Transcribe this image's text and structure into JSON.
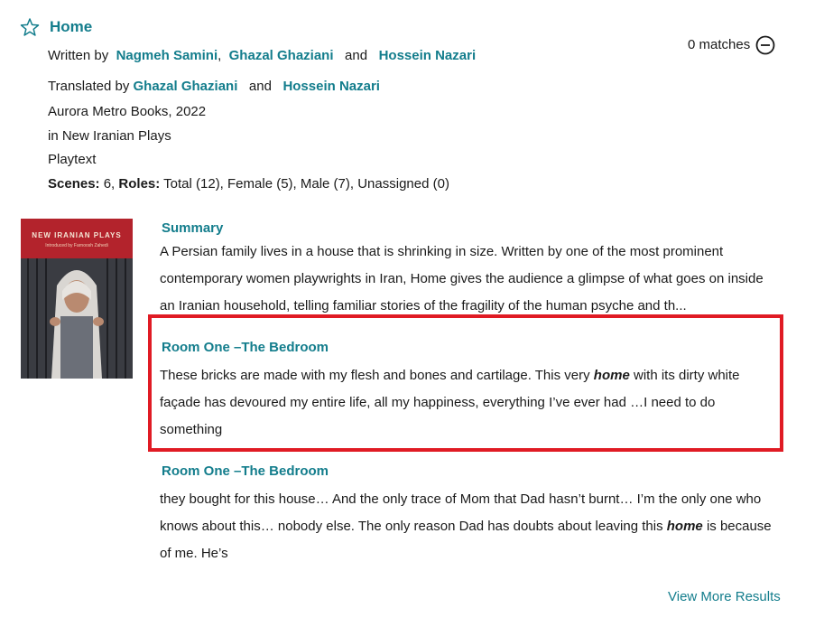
{
  "header": {
    "title": "Home",
    "written_by_label": "Written by",
    "authors": [
      "Nagmeh Samini",
      "Ghazal Ghaziani",
      "Hossein Nazari"
    ],
    "comma": ",",
    "and": "and",
    "translated_by_label": "Translated by",
    "translators": [
      "Ghazal Ghaziani",
      "Hossein Nazari"
    ],
    "publisher": "Aurora Metro Books, 2022",
    "collection": "in New Iranian Plays",
    "type": "Playtext",
    "scenes_label": "Scenes:",
    "scenes_value": "6,",
    "roles_label": "Roles:",
    "roles_value": "Total (12), Female (5), Male (7), Unassigned (0)"
  },
  "matches": {
    "text": "0 matches"
  },
  "cover": {
    "title": "NEW IRANIAN PLAYS",
    "subtitle": "Introduced by Farnoosh Zahedi"
  },
  "results": [
    {
      "heading": "Summary",
      "lines": [
        "A Persian family lives in a house that is shrinking in size. Written by one of the most prominent",
        "contemporary women playwrights in Iran, Home gives the audience a glimpse of what goes on inside",
        "an Iranian household, telling familiar stories of the fragility of the human psyche and th..."
      ]
    },
    {
      "heading": "Room One –The Bedroom",
      "line1_before": "These bricks are made with my flesh and bones and cartilage. This very",
      "line1_hl": "home",
      "line1_after": "with its dirty white",
      "line2": "façade has devoured my entire life, all my happiness, everything I’ve ever had …I need to do",
      "line3": "something"
    },
    {
      "heading": "Room One –The Bedroom",
      "line1": "they bought for this house… And the only trace of Mom that Dad hasn’t burnt… I’m the only one who",
      "line2_before": "knows about this… nobody else. The only reason Dad has doubts about leaving this",
      "line2_hl": "home",
      "line2_after": "is because",
      "line3": "of me. He’s"
    }
  ],
  "footer": {
    "view_more": "View More Results"
  },
  "colors": {
    "accent": "#137d8c",
    "highlight_border": "#e01b24"
  }
}
